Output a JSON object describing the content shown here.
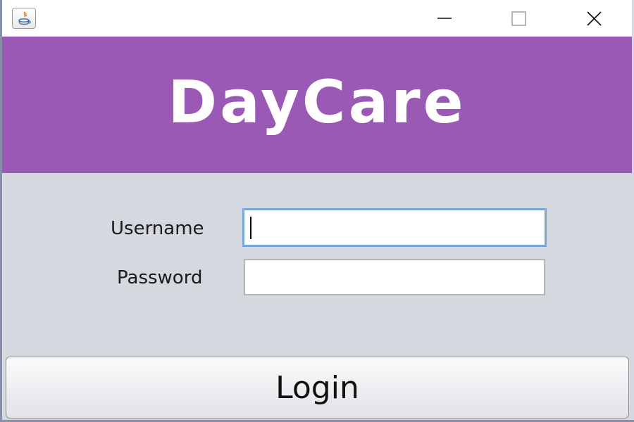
{
  "titlebar": {
    "icon": "java-icon",
    "controls": {
      "minimize": "minimize-icon",
      "maximize": "maximize-icon",
      "close": "close-icon"
    }
  },
  "header": {
    "brand": "DayCare",
    "background": "#9a59b5"
  },
  "form": {
    "username": {
      "label": "Username",
      "value": ""
    },
    "password": {
      "label": "Password",
      "value": ""
    }
  },
  "actions": {
    "login_label": "Login"
  },
  "colors": {
    "panel": "#d6d8df",
    "focus_border": "#7aa7d7"
  }
}
